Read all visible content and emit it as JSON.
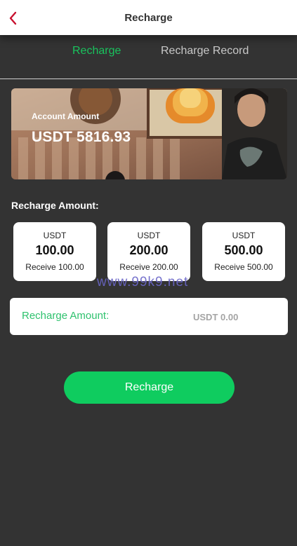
{
  "header": {
    "title": "Recharge",
    "back_icon": "chevron-left-icon"
  },
  "tabs": [
    {
      "label": "Recharge",
      "active": true
    },
    {
      "label": "Recharge Record",
      "active": false
    }
  ],
  "account": {
    "label": "Account Amount",
    "value": "USDT 5816.93"
  },
  "recharge": {
    "section_label": "Recharge Amount:",
    "options": [
      {
        "currency": "USDT",
        "amount": "100.00",
        "receive": "Receive 100.00"
      },
      {
        "currency": "USDT",
        "amount": "200.00",
        "receive": "Receive 200.00"
      },
      {
        "currency": "USDT",
        "amount": "500.00",
        "receive": "Receive 500.00"
      }
    ],
    "input_label": "Recharge Amount:",
    "input_value": "USDT 0.00",
    "submit_label": "Recharge"
  },
  "watermark": "www.99k9.net",
  "colors": {
    "accent": "#19c25d",
    "button": "#0fcc5f",
    "back_icon": "#c8102e",
    "background": "#333333"
  }
}
